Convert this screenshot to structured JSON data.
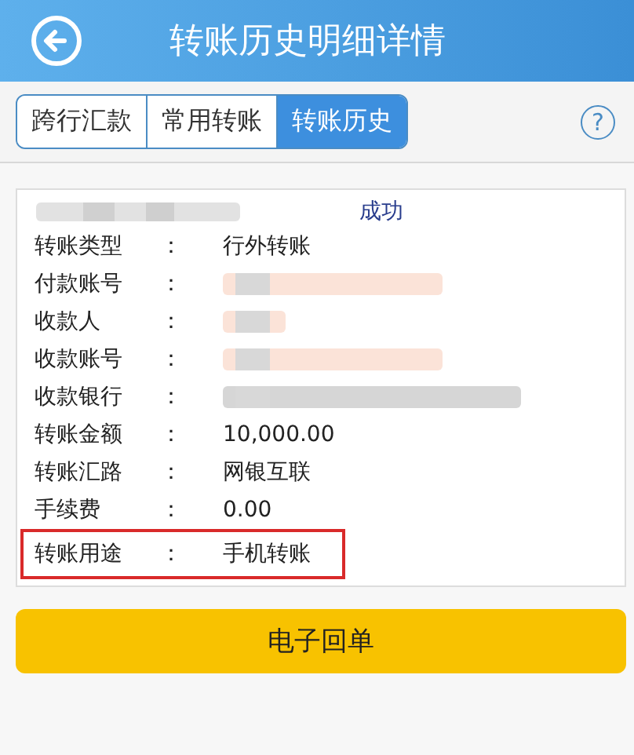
{
  "header": {
    "title": "转账历史明细详情"
  },
  "tabs": [
    {
      "label": "跨行汇款",
      "selected": false
    },
    {
      "label": "常用转账",
      "selected": false
    },
    {
      "label": "转账历史",
      "selected": true
    }
  ],
  "help": {
    "symbol": "?"
  },
  "record": {
    "status": "成功",
    "rows": [
      {
        "kind": "text",
        "label": "转账类型",
        "colon": "：",
        "value": "行外转账",
        "highlighted": false
      },
      {
        "kind": "redacted",
        "label": "付款账号",
        "colon": "：",
        "highlighted": false
      },
      {
        "kind": "redacted",
        "label": "收款人",
        "colon": "：",
        "highlighted": false
      },
      {
        "kind": "redacted",
        "label": "收款账号",
        "colon": "：",
        "highlighted": false
      },
      {
        "kind": "redacted",
        "label": "收款银行",
        "colon": "：",
        "highlighted": false
      },
      {
        "kind": "text",
        "label": "转账金额",
        "colon": "：",
        "value": "10,000.00",
        "highlighted": false
      },
      {
        "kind": "text",
        "label": "转账汇路",
        "colon": "：",
        "value": "网银互联",
        "highlighted": false
      },
      {
        "kind": "text",
        "label": "手续费",
        "colon": "：",
        "value": "0.00",
        "highlighted": false
      },
      {
        "kind": "text",
        "label": "转账用途",
        "colon": "：",
        "value": "手机转账",
        "highlighted": true
      }
    ]
  },
  "receipt_button": {
    "label": "电子回单"
  }
}
